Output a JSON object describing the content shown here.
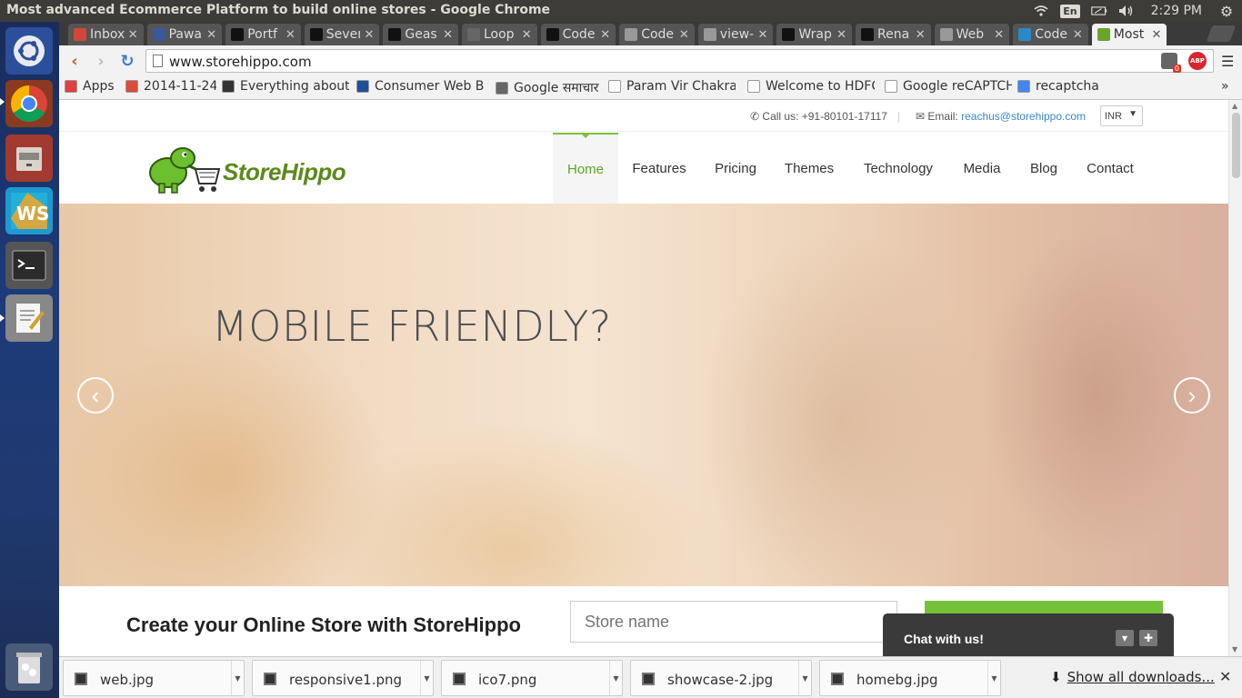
{
  "os": {
    "window_title": "Most advanced Ecommerce Platform to build online stores - Google Chrome",
    "keyboard": "En",
    "clock": "2:29 PM"
  },
  "browser": {
    "tabs": [
      {
        "label": "Inbox",
        "icon": "gmail-icon",
        "color": "#d44638"
      },
      {
        "label": "Pawa",
        "icon": "facebook-icon",
        "color": "#3b5998"
      },
      {
        "label": "Portf",
        "icon": "codepen-icon",
        "color": "#111111"
      },
      {
        "label": "Seven",
        "icon": "codepen-icon",
        "color": "#111111"
      },
      {
        "label": "Geas",
        "icon": "codepen-icon",
        "color": "#111111"
      },
      {
        "label": "Loop",
        "icon": "infinity-icon",
        "color": "#666666"
      },
      {
        "label": "Code",
        "icon": "codepen-icon",
        "color": "#111111"
      },
      {
        "label": "Code",
        "icon": "page-icon",
        "color": "#999999"
      },
      {
        "label": "view-",
        "icon": "page-icon",
        "color": "#999999"
      },
      {
        "label": "Wrap",
        "icon": "codepen-icon",
        "color": "#111111"
      },
      {
        "label": "Rena",
        "icon": "codepen-icon",
        "color": "#111111"
      },
      {
        "label": "Web",
        "icon": "page-icon",
        "color": "#999999"
      },
      {
        "label": "Code",
        "icon": "w3-icon",
        "color": "#2a8ac6"
      },
      {
        "label": "Most",
        "icon": "storehippo-icon",
        "color": "#6aa52e"
      }
    ],
    "url": "www.storehippo.com",
    "extension_badge": "0",
    "abp_label": "ABP",
    "bookmarks": [
      {
        "label": "Apps",
        "icon": "apps-grid-icon",
        "color": "#e04040"
      },
      {
        "label": "2014-11-24",
        "icon": "google-plus-icon",
        "color": "#dd4b39"
      },
      {
        "label": "Everything about",
        "icon": "facebook-icon",
        "color": "#333333"
      },
      {
        "label": "Consumer Web B",
        "icon": "bookmark-logo-icon",
        "color": "#1d4f9c"
      },
      {
        "label": "Google समाचार",
        "icon": "news-icon",
        "color": "#666666"
      },
      {
        "label": "Param Vir Chakra",
        "icon": "wikipedia-icon",
        "color": "#ffffff"
      },
      {
        "label": "Welcome to HDFC",
        "icon": "page-icon",
        "color": "#ffffff"
      },
      {
        "label": "Google reCAPTCHA",
        "icon": "page-icon",
        "color": "#ffffff"
      },
      {
        "label": "recaptcha",
        "icon": "google-icon",
        "color": "#4285f4"
      }
    ],
    "bookmarks_more": "»"
  },
  "site": {
    "call_label": "Call us: +91-80101-17117",
    "email_prefix": "Email: ",
    "email": "reachus@storehippo.com",
    "currency": "INR",
    "brand": "StoreHippo",
    "nav": [
      "Home",
      "Features",
      "Pricing",
      "Themes",
      "Technology",
      "Media",
      "Blog",
      "Contact"
    ],
    "active_nav": "Home",
    "hero_headline": "MOBILE FRIENDLY?",
    "create_heading": "Create your Online Store with StoreHippo",
    "store_name_placeholder": "Store name",
    "chat_label": "Chat with us!",
    "accent_color": "#74c13a"
  },
  "downloads": {
    "items": [
      "web.jpg",
      "responsive1.png",
      "ico7.png",
      "showcase-2.jpg",
      "homebg.jpg"
    ],
    "show_all": "Show all downloads..."
  }
}
